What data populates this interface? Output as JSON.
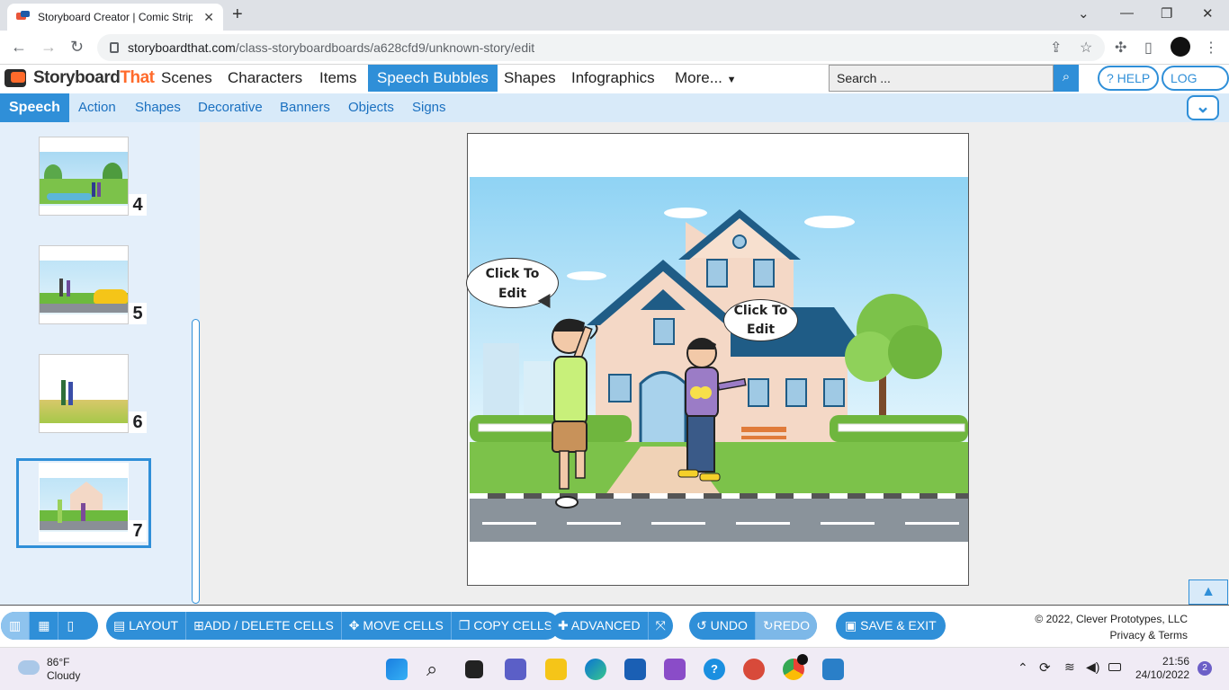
{
  "browser": {
    "tab_title": "Storyboard Creator | Comic Strip",
    "url_domain": "storyboardthat.com",
    "url_path": "/class-storyboardboards/a628cfd9/unknown-story/edit"
  },
  "appnav": {
    "logo_part1": "Storyboard",
    "logo_part2": "That",
    "items": [
      "Scenes",
      "Characters",
      "Items",
      "Speech Bubbles",
      "Shapes",
      "Infographics",
      "More..."
    ],
    "active_item": "Speech Bubbles",
    "search_placeholder": "Search ...",
    "help": "? HELP",
    "logout": "LOG OUT"
  },
  "subnav": {
    "items": [
      "Speech",
      "Action",
      "Shapes",
      "Decorative",
      "Banners",
      "Objects",
      "Signs"
    ],
    "active_item": "Speech"
  },
  "sidebar": {
    "cells": [
      {
        "number": "4"
      },
      {
        "number": "5"
      },
      {
        "number": "6"
      },
      {
        "number": "7",
        "selected": true
      }
    ]
  },
  "canvas": {
    "bubble_left": [
      "Click To",
      "Edit"
    ],
    "bubble_right": [
      "Click To",
      "Edit"
    ]
  },
  "bottombar": {
    "layout": "LAYOUT",
    "add_delete": "ADD / DELETE CELLS",
    "move": "MOVE CELLS",
    "copy": "COPY CELLS",
    "advanced": "ADVANCED",
    "undo": "UNDO",
    "redo": "REDO",
    "save_exit": "SAVE & EXIT",
    "copyright": "© 2022, Clever Prototypes, LLC",
    "privacy": "Privacy & Terms"
  },
  "taskbar": {
    "weather_temp": "86°F",
    "weather_desc": "Cloudy",
    "time": "21:56",
    "date": "24/10/2022",
    "notif_count": "2"
  },
  "colors": {
    "accent": "#2f8fd8",
    "logo_orange": "#ff6a2b",
    "sidebar_bg": "#e4effa"
  }
}
